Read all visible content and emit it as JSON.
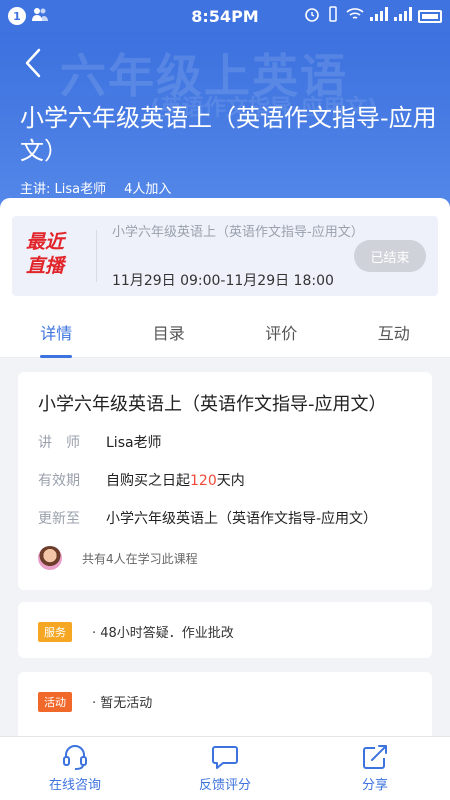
{
  "status_bar": {
    "notification_count": "1",
    "time": "8:54PM",
    "network": "4G",
    "network2": "4G"
  },
  "hero": {
    "watermark_line1": "六年级上英语",
    "watermark_line2": "(英语作文指导-应用文)",
    "title": "小学六年级英语上（英语作文指导-应用文）",
    "teacher_label": "主讲: Lisa老师",
    "enrolled": "4人加入"
  },
  "live": {
    "badge_line1": "最近",
    "badge_line2": "直播",
    "title": "小学六年级英语上（英语作文指导-应用文）",
    "time": "11月29日 09:00-11月29日 18:00",
    "status": "已结束"
  },
  "tabs": [
    "详情",
    "目录",
    "评价",
    "互动"
  ],
  "detail": {
    "title": "小学六年级英语上（英语作文指导-应用文）",
    "teacher_label": "讲　师",
    "teacher_value": "Lisa老师",
    "validity_label": "有效期",
    "validity_prefix": "自购买之日起",
    "validity_days": "120",
    "validity_suffix": "天内",
    "update_label": "更新至",
    "update_value": "小学六年级英语上（英语作文指导-应用文）",
    "learners": "共有4人在学习此课程"
  },
  "service": {
    "tag": "服务",
    "text": "· 48小时答疑．作业批改"
  },
  "activity": {
    "tag": "活动",
    "text": "· 暂无活动"
  },
  "bottom_nav": {
    "consult": "在线咨询",
    "feedback": "反馈评分",
    "share": "分享"
  },
  "colors": {
    "primary": "#3d73de",
    "live_red": "#e1252a",
    "highlight": "#f04a3a"
  }
}
